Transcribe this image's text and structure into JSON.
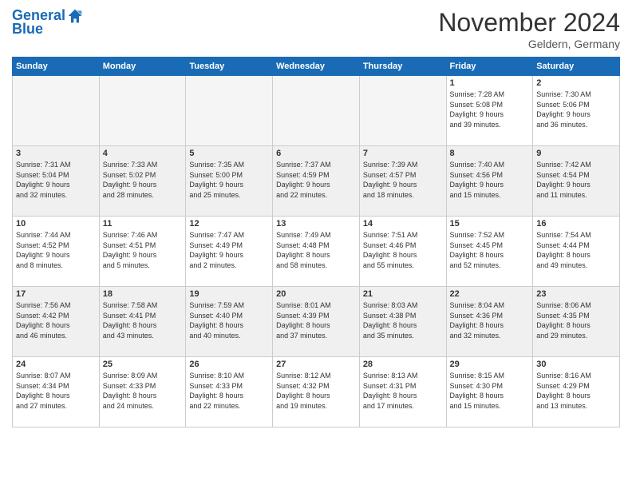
{
  "logo": {
    "line1": "General",
    "line2": "Blue"
  },
  "title": "November 2024",
  "location": "Geldern, Germany",
  "days_of_week": [
    "Sunday",
    "Monday",
    "Tuesday",
    "Wednesday",
    "Thursday",
    "Friday",
    "Saturday"
  ],
  "weeks": [
    [
      {
        "day": "",
        "info": "",
        "empty": true
      },
      {
        "day": "",
        "info": "",
        "empty": true
      },
      {
        "day": "",
        "info": "",
        "empty": true
      },
      {
        "day": "",
        "info": "",
        "empty": true
      },
      {
        "day": "",
        "info": "",
        "empty": true
      },
      {
        "day": "1",
        "info": "Sunrise: 7:28 AM\nSunset: 5:08 PM\nDaylight: 9 hours\nand 39 minutes."
      },
      {
        "day": "2",
        "info": "Sunrise: 7:30 AM\nSunset: 5:06 PM\nDaylight: 9 hours\nand 36 minutes."
      }
    ],
    [
      {
        "day": "3",
        "info": "Sunrise: 7:31 AM\nSunset: 5:04 PM\nDaylight: 9 hours\nand 32 minutes."
      },
      {
        "day": "4",
        "info": "Sunrise: 7:33 AM\nSunset: 5:02 PM\nDaylight: 9 hours\nand 28 minutes."
      },
      {
        "day": "5",
        "info": "Sunrise: 7:35 AM\nSunset: 5:00 PM\nDaylight: 9 hours\nand 25 minutes."
      },
      {
        "day": "6",
        "info": "Sunrise: 7:37 AM\nSunset: 4:59 PM\nDaylight: 9 hours\nand 22 minutes."
      },
      {
        "day": "7",
        "info": "Sunrise: 7:39 AM\nSunset: 4:57 PM\nDaylight: 9 hours\nand 18 minutes."
      },
      {
        "day": "8",
        "info": "Sunrise: 7:40 AM\nSunset: 4:56 PM\nDaylight: 9 hours\nand 15 minutes."
      },
      {
        "day": "9",
        "info": "Sunrise: 7:42 AM\nSunset: 4:54 PM\nDaylight: 9 hours\nand 11 minutes."
      }
    ],
    [
      {
        "day": "10",
        "info": "Sunrise: 7:44 AM\nSunset: 4:52 PM\nDaylight: 9 hours\nand 8 minutes."
      },
      {
        "day": "11",
        "info": "Sunrise: 7:46 AM\nSunset: 4:51 PM\nDaylight: 9 hours\nand 5 minutes."
      },
      {
        "day": "12",
        "info": "Sunrise: 7:47 AM\nSunset: 4:49 PM\nDaylight: 9 hours\nand 2 minutes."
      },
      {
        "day": "13",
        "info": "Sunrise: 7:49 AM\nSunset: 4:48 PM\nDaylight: 8 hours\nand 58 minutes."
      },
      {
        "day": "14",
        "info": "Sunrise: 7:51 AM\nSunset: 4:46 PM\nDaylight: 8 hours\nand 55 minutes."
      },
      {
        "day": "15",
        "info": "Sunrise: 7:52 AM\nSunset: 4:45 PM\nDaylight: 8 hours\nand 52 minutes."
      },
      {
        "day": "16",
        "info": "Sunrise: 7:54 AM\nSunset: 4:44 PM\nDaylight: 8 hours\nand 49 minutes."
      }
    ],
    [
      {
        "day": "17",
        "info": "Sunrise: 7:56 AM\nSunset: 4:42 PM\nDaylight: 8 hours\nand 46 minutes."
      },
      {
        "day": "18",
        "info": "Sunrise: 7:58 AM\nSunset: 4:41 PM\nDaylight: 8 hours\nand 43 minutes."
      },
      {
        "day": "19",
        "info": "Sunrise: 7:59 AM\nSunset: 4:40 PM\nDaylight: 8 hours\nand 40 minutes."
      },
      {
        "day": "20",
        "info": "Sunrise: 8:01 AM\nSunset: 4:39 PM\nDaylight: 8 hours\nand 37 minutes."
      },
      {
        "day": "21",
        "info": "Sunrise: 8:03 AM\nSunset: 4:38 PM\nDaylight: 8 hours\nand 35 minutes."
      },
      {
        "day": "22",
        "info": "Sunrise: 8:04 AM\nSunset: 4:36 PM\nDaylight: 8 hours\nand 32 minutes."
      },
      {
        "day": "23",
        "info": "Sunrise: 8:06 AM\nSunset: 4:35 PM\nDaylight: 8 hours\nand 29 minutes."
      }
    ],
    [
      {
        "day": "24",
        "info": "Sunrise: 8:07 AM\nSunset: 4:34 PM\nDaylight: 8 hours\nand 27 minutes."
      },
      {
        "day": "25",
        "info": "Sunrise: 8:09 AM\nSunset: 4:33 PM\nDaylight: 8 hours\nand 24 minutes."
      },
      {
        "day": "26",
        "info": "Sunrise: 8:10 AM\nSunset: 4:33 PM\nDaylight: 8 hours\nand 22 minutes."
      },
      {
        "day": "27",
        "info": "Sunrise: 8:12 AM\nSunset: 4:32 PM\nDaylight: 8 hours\nand 19 minutes."
      },
      {
        "day": "28",
        "info": "Sunrise: 8:13 AM\nSunset: 4:31 PM\nDaylight: 8 hours\nand 17 minutes."
      },
      {
        "day": "29",
        "info": "Sunrise: 8:15 AM\nSunset: 4:30 PM\nDaylight: 8 hours\nand 15 minutes."
      },
      {
        "day": "30",
        "info": "Sunrise: 8:16 AM\nSunset: 4:29 PM\nDaylight: 8 hours\nand 13 minutes."
      }
    ]
  ]
}
